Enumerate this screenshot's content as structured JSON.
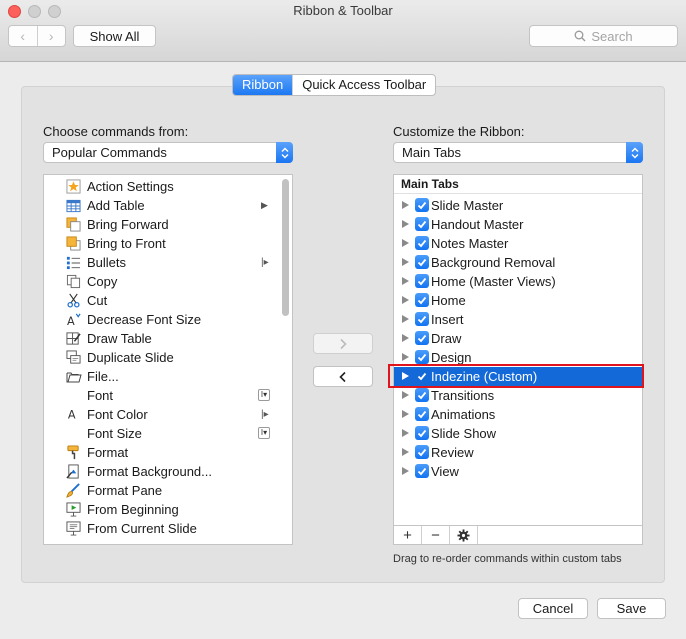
{
  "window": {
    "title": "Ribbon & Toolbar"
  },
  "toolbar": {
    "show_all_label": "Show All",
    "search_placeholder": "Search"
  },
  "tabs": [
    {
      "label": "Ribbon",
      "active": true
    },
    {
      "label": "Quick Access Toolbar",
      "active": false
    }
  ],
  "left": {
    "label": "Choose commands from:",
    "select_value": "Popular Commands",
    "commands": [
      {
        "label": "Action Settings",
        "icon": "star-icon"
      },
      {
        "label": "Add Table",
        "icon": "table-icon",
        "submenu": "arrow"
      },
      {
        "label": "Bring Forward",
        "icon": "bring-forward-icon"
      },
      {
        "label": "Bring to Front",
        "icon": "bring-to-front-icon"
      },
      {
        "label": "Bullets",
        "icon": "bullets-icon",
        "submenu": "split"
      },
      {
        "label": "Copy",
        "icon": "copy-icon"
      },
      {
        "label": "Cut",
        "icon": "scissors-icon"
      },
      {
        "label": "Decrease Font Size",
        "icon": "decrease-font-icon"
      },
      {
        "label": "Draw Table",
        "icon": "draw-table-icon"
      },
      {
        "label": "Duplicate Slide",
        "icon": "duplicate-slide-icon"
      },
      {
        "label": "File...",
        "icon": "folder-icon"
      },
      {
        "label": "Font",
        "icon": "",
        "submenu": "dropdown"
      },
      {
        "label": "Font Color",
        "icon": "font-color-icon",
        "submenu": "split"
      },
      {
        "label": "Font Size",
        "icon": "",
        "submenu": "dropdown"
      },
      {
        "label": "Format",
        "icon": "format-painter-icon"
      },
      {
        "label": "Format Background...",
        "icon": "format-background-icon"
      },
      {
        "label": "Format Pane",
        "icon": "brush-icon"
      },
      {
        "label": "From Beginning",
        "icon": "slideshow-start-icon"
      },
      {
        "label": "From Current Slide",
        "icon": "slideshow-current-icon"
      }
    ]
  },
  "right": {
    "label": "Customize the Ribbon:",
    "select_value": "Main Tabs",
    "header": "Main Tabs",
    "tabs": [
      {
        "label": "Slide Master",
        "checked": true
      },
      {
        "label": "Handout Master",
        "checked": true
      },
      {
        "label": "Notes Master",
        "checked": true
      },
      {
        "label": "Background Removal",
        "checked": true
      },
      {
        "label": "Home (Master Views)",
        "checked": true
      },
      {
        "label": "Home",
        "checked": true
      },
      {
        "label": "Insert",
        "checked": true
      },
      {
        "label": "Draw",
        "checked": true
      },
      {
        "label": "Design",
        "checked": true
      },
      {
        "label": "Indezine (Custom)",
        "checked": true,
        "selected": true
      },
      {
        "label": "Transitions",
        "checked": true
      },
      {
        "label": "Animations",
        "checked": true
      },
      {
        "label": "Slide Show",
        "checked": true
      },
      {
        "label": "Review",
        "checked": true
      },
      {
        "label": "View",
        "checked": true
      }
    ],
    "footer_buttons": [
      "+",
      "−",
      "gear-icon"
    ],
    "hint": "Drag to re-order commands within custom tabs"
  },
  "buttons": {
    "cancel": "Cancel",
    "save": "Save"
  },
  "colors": {
    "accent": "#1b76f2",
    "selection": "#1469d9",
    "highlight_box": "#e0141c"
  }
}
